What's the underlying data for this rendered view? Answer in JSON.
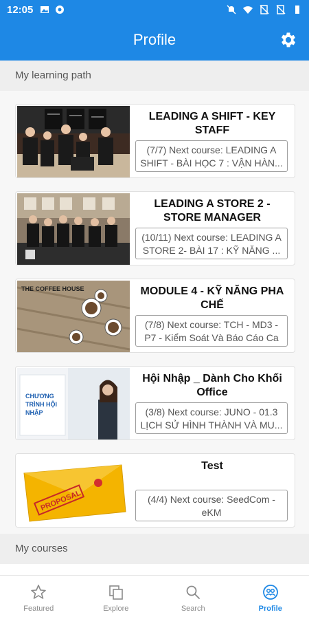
{
  "status_bar": {
    "time": "12:05"
  },
  "app_bar": {
    "title": "Profile",
    "settings_icon": "gear-icon"
  },
  "sections": {
    "learning_path": "My learning path",
    "my_courses": "My courses"
  },
  "learning_path": [
    {
      "title": "LEADING A SHIFT - KEY STAFF",
      "next": "(7/7) Next course: LEADING A SHIFT - BÀI HỌC 7 : VẬN HÀN..."
    },
    {
      "title": "LEADING A STORE 2 - STORE MANAGER",
      "next": "(10/11) Next course: LEADING A STORE 2- BÀI 17 : KỸ NĂNG ..."
    },
    {
      "title": "MODULE 4 - KỸ NĂNG PHA CHẾ",
      "next": "(7/8) Next course: TCH - MD3 - P7 - Kiểm Soát Và Báo Cáo Ca",
      "thumb_text": "THE COFFEE HOUSE"
    },
    {
      "title": "Hội Nhập _ Dành Cho Khối Office",
      "next": "(3/8) Next course: JUNO - 01.3 LỊCH SỬ HÌNH THÀNH VÀ MU...",
      "thumb_text_1": "CHƯƠNG",
      "thumb_text_2": "TRÌNH HỘI",
      "thumb_text_3": "NHẬP"
    },
    {
      "title": "Test",
      "next": "(4/4) Next course: SeedCom - eKM",
      "thumb_text": "PROPOSAL"
    }
  ],
  "bottom_nav": [
    {
      "label": "Featured",
      "icon": "star-icon"
    },
    {
      "label": "Explore",
      "icon": "copy-icon"
    },
    {
      "label": "Search",
      "icon": "search-icon"
    },
    {
      "label": "Profile",
      "icon": "profile-icon",
      "active": true
    }
  ],
  "colors": {
    "primary": "#1e88e5",
    "section_bg": "#eeeeee"
  }
}
